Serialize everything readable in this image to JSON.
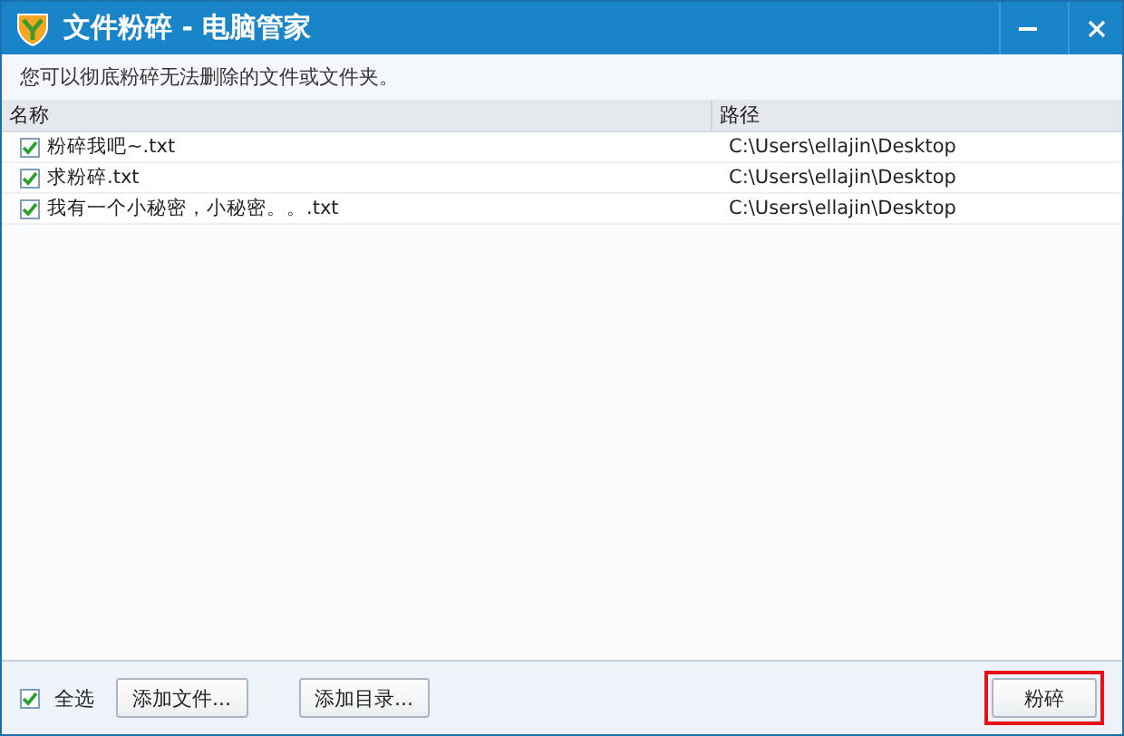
{
  "window": {
    "title": "文件粉碎 - 电脑管家"
  },
  "description": "您可以彻底粉碎无法删除的文件或文件夹。",
  "table": {
    "columns": [
      "名称",
      "路径"
    ],
    "rows": [
      {
        "name": "粉碎我吧~.txt",
        "path": "C:\\Users\\ellajin\\Desktop",
        "checked": true
      },
      {
        "name": "求粉碎.txt",
        "path": "C:\\Users\\ellajin\\Desktop",
        "checked": true
      },
      {
        "name": "我有一个小秘密，小秘密。。.txt",
        "path": "C:\\Users\\ellajin\\Desktop",
        "checked": true
      }
    ]
  },
  "footer": {
    "select_all": {
      "label": "全选",
      "checked": true
    },
    "buttons": [
      "添加文件...",
      "添加目录..."
    ],
    "action": {
      "label": "粉碎",
      "highlighted": true
    }
  }
}
